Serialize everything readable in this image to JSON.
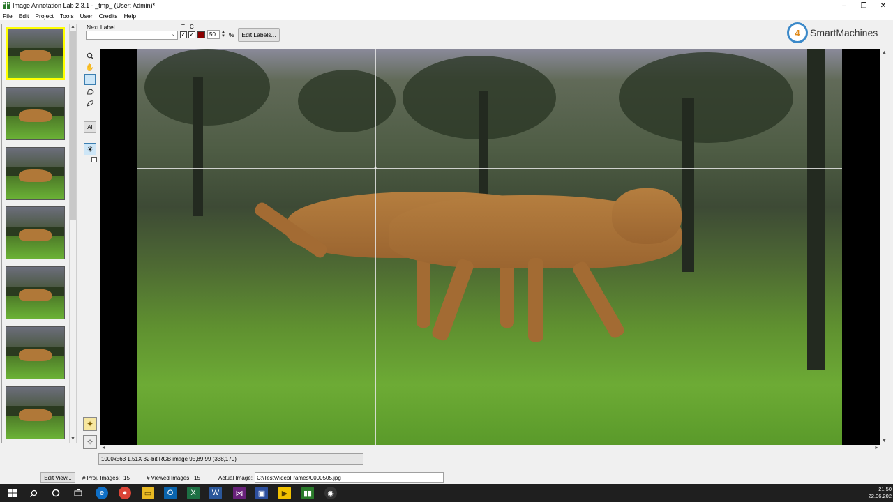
{
  "window": {
    "title": "Image Annotation Lab 2.3.1 - _tmp_ (User: Admin)*",
    "minimize_icon": "–",
    "maximize_icon": "❐",
    "close_icon": "✕"
  },
  "menu": [
    "File",
    "Edit",
    "Project",
    "Tools",
    "User",
    "Credits",
    "Help"
  ],
  "toolbar": {
    "next_label_caption": "Next Label",
    "next_label_value": "",
    "t_caption": "T",
    "c_caption": "C",
    "t_checked": true,
    "c_checked": true,
    "label_color": "#8b0000",
    "opacity_value": "50",
    "opacity_unit": "%",
    "edit_labels": "Edit Labels..."
  },
  "logo": {
    "mark": "4",
    "name": "SmartMachines"
  },
  "tools": {
    "ai_label": "AI"
  },
  "image_info": "1000x563 1.51X 32-bit RGB image 95,89,99    (338,170)",
  "status": {
    "edit_view": "Edit View...",
    "proj_images_label": "# Proj. Images:",
    "proj_images_value": "15",
    "viewed_images_label": "# Viewed Images:",
    "viewed_images_value": "15",
    "actual_image_label": "Actual Image:",
    "actual_image_path": "C:\\Test\\VideoFrames\\0000505.jpg"
  },
  "clock": {
    "time": "21:50",
    "date": "22.06.202"
  }
}
